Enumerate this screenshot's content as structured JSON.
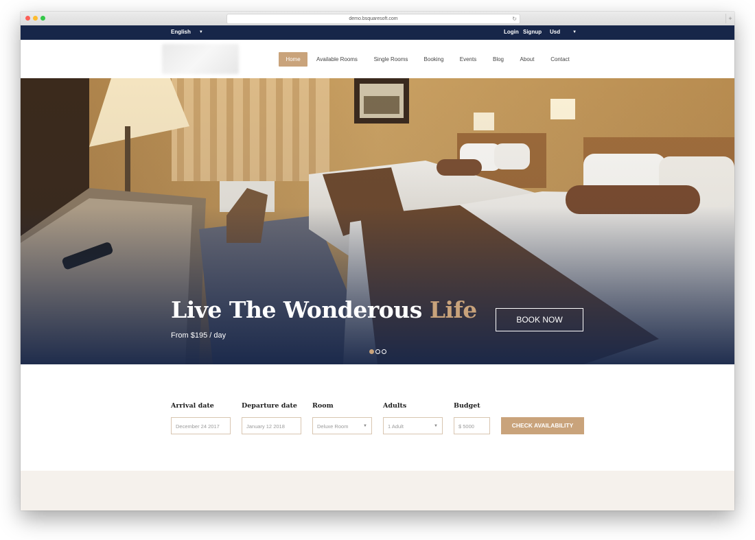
{
  "browser": {
    "url": "demo.bsquaresoft.com"
  },
  "topbar": {
    "language": "English",
    "login": "Login",
    "signup": "Signup",
    "currency": "Usd"
  },
  "nav": {
    "items": [
      {
        "label": "Home",
        "active": true
      },
      {
        "label": "Available Rooms"
      },
      {
        "label": "Single Rooms"
      },
      {
        "label": "Booking"
      },
      {
        "label": "Events"
      },
      {
        "label": "Blog"
      },
      {
        "label": "About"
      },
      {
        "label": "Contact"
      }
    ]
  },
  "hero": {
    "title_main": "Live The Wonderous",
    "title_accent": "Life",
    "subtitle": "From $195 / day",
    "cta": "BOOK NOW",
    "slides": 3,
    "active_slide": 1
  },
  "booking": {
    "arrival_label": "Arrival date",
    "arrival_value": "December 24 2017",
    "departure_label": "Departure date",
    "departure_value": "January 12 2018",
    "room_label": "Room",
    "room_value": "Deluxe Room",
    "adults_label": "Adults",
    "adults_value": "1 Adult",
    "budget_label": "Budget",
    "budget_value": "$ 5000",
    "submit": "CHECK AVAILABILITY"
  },
  "colors": {
    "navy": "#172649",
    "accent": "#c9a37b",
    "footer": "#f5f1ec"
  },
  "icons": [
    "reload-icon",
    "plus-icon",
    "caret-down-icon",
    "select-arrow-icon"
  ]
}
